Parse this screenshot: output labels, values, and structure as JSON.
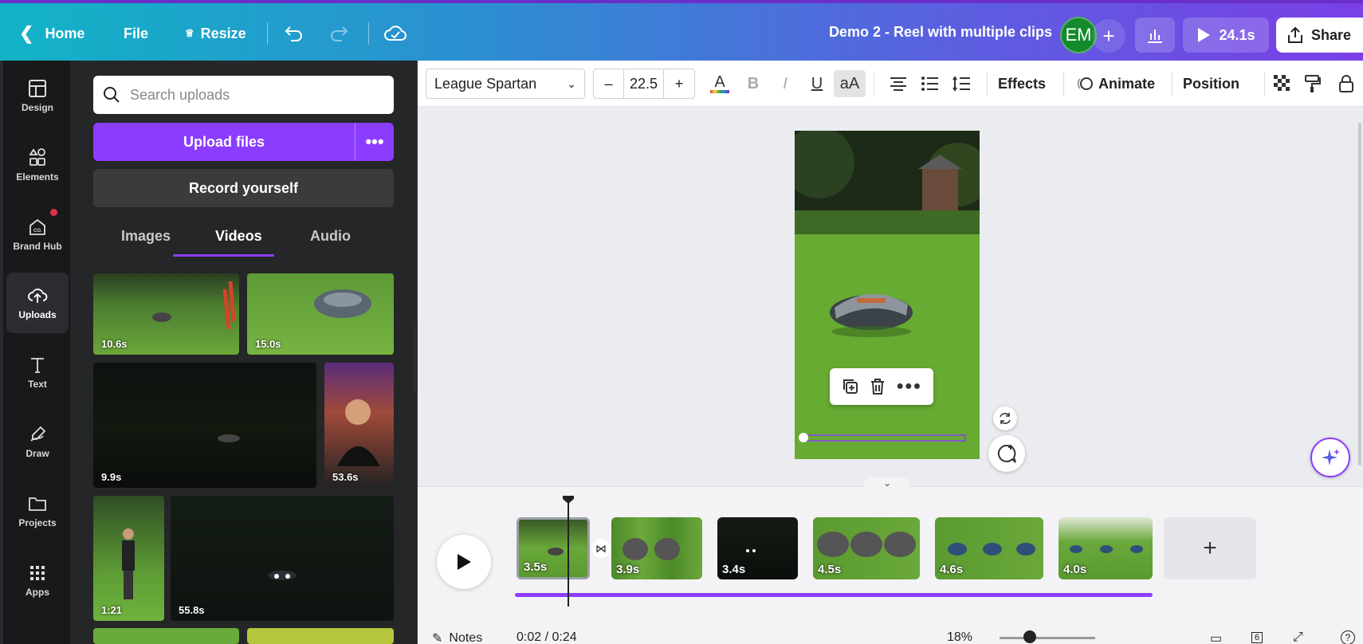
{
  "topbar": {
    "home_label": "Home",
    "file_label": "File",
    "resize_label": "Resize",
    "design_title": "Demo 2 - Reel with multiple clips",
    "avatar_initials": "EM",
    "duration_label": "24.1s",
    "share_label": "Share"
  },
  "rail": {
    "design": "Design",
    "elements": "Elements",
    "brand_hub": "Brand Hub",
    "uploads": "Uploads",
    "text": "Text",
    "draw": "Draw",
    "projects": "Projects",
    "apps": "Apps"
  },
  "panel": {
    "search_placeholder": "Search uploads",
    "upload_label": "Upload files",
    "record_label": "Record yourself",
    "tabs": [
      "Images",
      "Videos",
      "Audio"
    ],
    "active_tab": "Videos",
    "videos": [
      {
        "duration": "10.6s"
      },
      {
        "duration": "15.0s"
      },
      {
        "duration": "9.9s"
      },
      {
        "duration": "53.6s"
      },
      {
        "duration": "1:21"
      },
      {
        "duration": "55.8s"
      }
    ]
  },
  "toolbar": {
    "font_name": "League Spartan",
    "font_size": "22.5",
    "effects_label": "Effects",
    "animate_label": "Animate",
    "position_label": "Position"
  },
  "timeline": {
    "clips": [
      {
        "duration": "3.5s"
      },
      {
        "duration": "3.9s"
      },
      {
        "duration": "3.4s"
      },
      {
        "duration": "4.5s"
      },
      {
        "duration": "4.6s"
      },
      {
        "duration": "4.0s"
      }
    ],
    "notes_label": "Notes",
    "time_label": "0:02 / 0:24",
    "zoom_label": "18%",
    "page_count": "6"
  },
  "colors": {
    "accent": "#8b3dff",
    "avatar": "#138a2c",
    "rail_bg": "#18191b",
    "panel_bg": "#252627"
  }
}
